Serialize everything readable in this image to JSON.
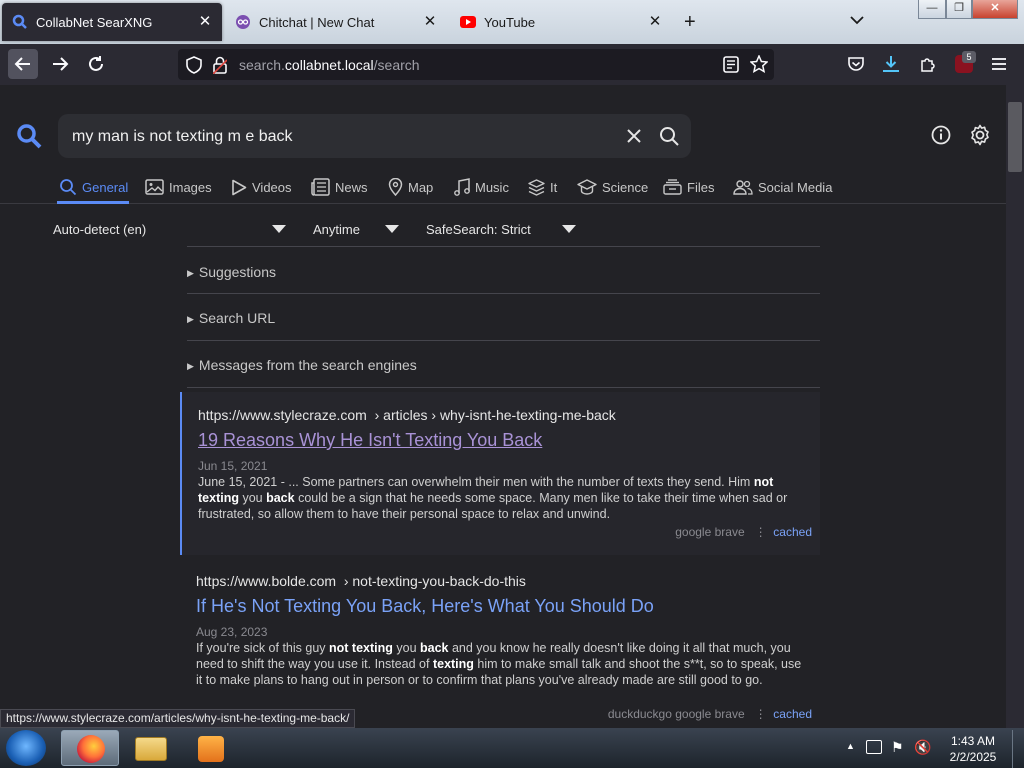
{
  "browser": {
    "tabs": [
      {
        "label": "CollabNet SearXNG",
        "active": true
      },
      {
        "label": "Chitchat | New Chat",
        "active": false
      },
      {
        "label": "YouTube",
        "active": false
      }
    ],
    "url_prefix": "search.",
    "url_domain": "collabnet.local",
    "url_path": "/search",
    "extensions_badge": "5"
  },
  "search": {
    "query": "my man is not texting m e back",
    "categories": [
      {
        "label": "General",
        "icon": "search-icon",
        "selected": true
      },
      {
        "label": "Images",
        "icon": "image-icon"
      },
      {
        "label": "Videos",
        "icon": "play-icon"
      },
      {
        "label": "News",
        "icon": "newspaper-icon"
      },
      {
        "label": "Map",
        "icon": "map-pin-icon"
      },
      {
        "label": "Music",
        "icon": "music-icon"
      },
      {
        "label": "It",
        "icon": "layers-icon"
      },
      {
        "label": "Science",
        "icon": "graduation-icon"
      },
      {
        "label": "Files",
        "icon": "files-icon"
      },
      {
        "label": "Social Media",
        "icon": "people-icon"
      }
    ],
    "filters": {
      "language": "Auto-detect (en)",
      "time": "Anytime",
      "safesearch": "SafeSearch: Strict"
    },
    "panels": [
      "Suggestions",
      "Search URL",
      "Messages from the search engines"
    ]
  },
  "results": [
    {
      "url_host": "https://www.stylecraze.com",
      "url_path": "› articles › why-isnt-he-texting-me-back",
      "title": "19 Reasons Why He Isn't Texting You Back",
      "date": "Jun 15, 2021",
      "desc_parts": [
        {
          "t": "June 15, 2021 - ... Some partners can overwhelm their men with the number of texts they send. Him "
        },
        {
          "t": "not texting",
          "b": true
        },
        {
          "t": " you "
        },
        {
          "t": "back",
          "b": true
        },
        {
          "t": " could be a sign that he needs some space. Many men like to take their time when sad or frustrated, so allow them to have their personal space to relax and unwind."
        }
      ],
      "engines": "google   brave",
      "cached": "cached"
    },
    {
      "url_host": "https://www.bolde.com",
      "url_path": "› not-texting-you-back-do-this",
      "title": "If He's Not Texting You Back, Here's What You Should Do",
      "date": "Aug 23, 2023",
      "desc_parts": [
        {
          "t": "If you're sick of this guy "
        },
        {
          "t": "not texting",
          "b": true
        },
        {
          "t": " you "
        },
        {
          "t": "back",
          "b": true
        },
        {
          "t": " and you know he really doesn't like doing it all that much, you need to shift the way you use it. Instead of "
        },
        {
          "t": "texting",
          "b": true
        },
        {
          "t": " him to make small talk and shoot the s**t, so to speak, use it to make plans to hang out in person or to confirm that plans you've already made are still good to go."
        }
      ],
      "engines": "duckduckgo   google   brave",
      "cached": "cached"
    }
  ],
  "status_link": "https://www.stylecraze.com/articles/why-isnt-he-texting-me-back/",
  "taskbar": {
    "time": "1:43 AM",
    "date": "2/2/2025"
  },
  "colors": {
    "accent": "#5b8bf5",
    "visited": "#a992d6",
    "link": "#7aa2f7"
  }
}
